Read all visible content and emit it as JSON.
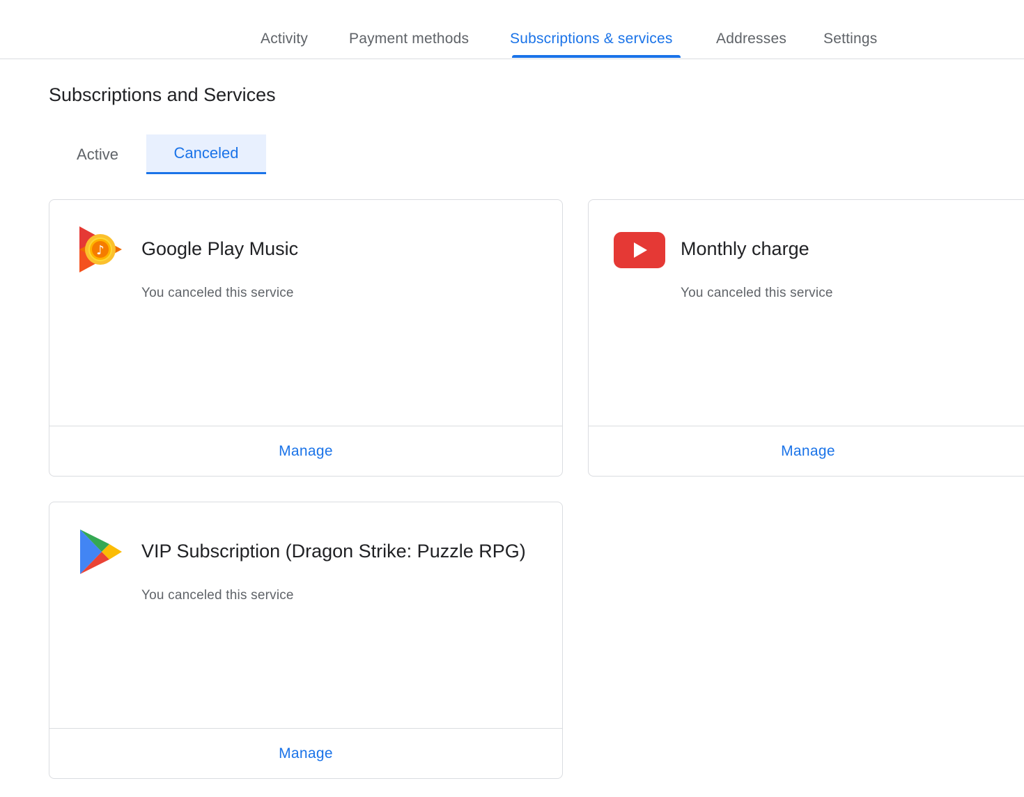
{
  "top_nav": {
    "tabs": [
      {
        "label": "Activity",
        "active": false
      },
      {
        "label": "Payment methods",
        "active": false
      },
      {
        "label": "Subscriptions & services",
        "active": true
      },
      {
        "label": "Addresses",
        "active": false
      },
      {
        "label": "Settings",
        "active": false
      }
    ]
  },
  "page_title": "Subscriptions and Services",
  "status_tabs": [
    {
      "label": "Active",
      "active": false
    },
    {
      "label": "Canceled",
      "active": true
    }
  ],
  "cards": [
    {
      "icon": "google-play-music-icon",
      "title": "Google Play Music",
      "status": "You canceled this service",
      "action_label": "Manage"
    },
    {
      "icon": "youtube-icon",
      "title": "Monthly charge",
      "status": "You canceled this service",
      "action_label": "Manage"
    },
    {
      "icon": "google-play-icon",
      "title": "VIP Subscription (Dragon Strike: Puzzle RPG)",
      "status": "You canceled this service",
      "action_label": "Manage"
    }
  ],
  "colors": {
    "accent": "#1a73e8",
    "accent_bg": "#e8f0fe",
    "border": "#dadce0",
    "text_primary": "#202124",
    "text_secondary": "#5f6368",
    "youtube_red": "#e53935"
  }
}
